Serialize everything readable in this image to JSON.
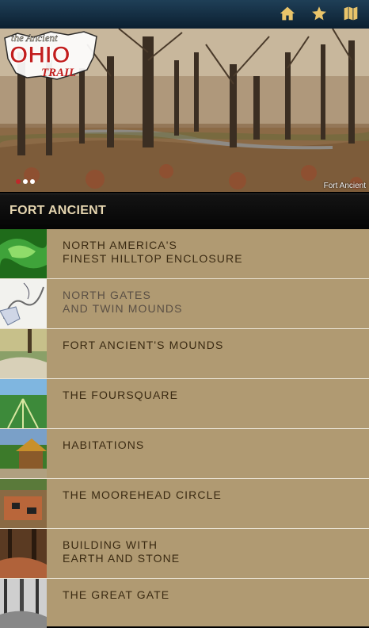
{
  "header": {
    "icons": [
      "home-icon",
      "star-icon",
      "map-icon"
    ]
  },
  "logo": {
    "text_the": "the Ancient",
    "text_ohio": "OHIO",
    "text_trail": "TRAIL"
  },
  "hero": {
    "caption": "Fort Ancient",
    "slide_count": 3,
    "active_slide": 1
  },
  "section": {
    "title": "FORT ANCIENT"
  },
  "items": [
    {
      "label": "NORTH AMERICA'S\nFINEST HILLTOP ENCLOSURE"
    },
    {
      "label": "NORTH GATES\nAND TWIN MOUNDS"
    },
    {
      "label": "FORT ANCIENT'S MOUNDS"
    },
    {
      "label": "THE FOURSQUARE"
    },
    {
      "label": "HABITATIONS"
    },
    {
      "label": "THE MOOREHEAD CIRCLE"
    },
    {
      "label": "BUILDING WITH\nEARTH AND STONE"
    },
    {
      "label": "THE GREAT GATE"
    }
  ],
  "colors": {
    "accent": "#e9c46a",
    "list_bg": "#b09a72",
    "list_text": "#3a2a12"
  }
}
